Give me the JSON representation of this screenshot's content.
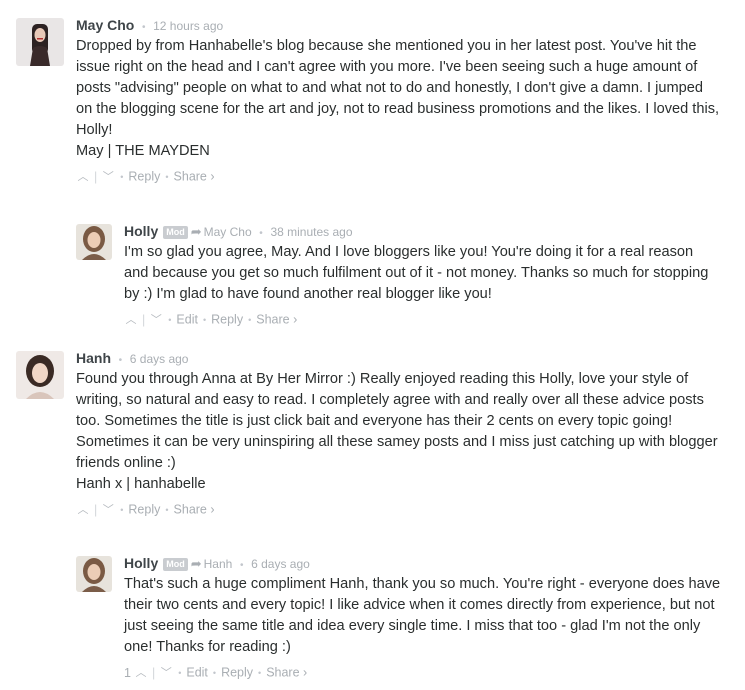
{
  "comments": [
    {
      "author": "May Cho",
      "time": "12 hours ago",
      "paragraphs": [
        "Dropped by from Hanhabelle's blog because she mentioned you in her latest post. You've hit the issue right on the head and I can't agree with you more. I've been seeing such a huge amount of posts \"advising\" people on what to and what not to do and honestly, I don't give a damn. I jumped on the blogging scene for the art and joy, not to read business promotions and the likes. I loved this, Holly!",
        "May | THE MAYDEN"
      ],
      "actions": {
        "reply": "Reply",
        "share": "Share ›"
      },
      "reply": {
        "author": "Holly",
        "badge": "Mod",
        "reply_to": "May Cho",
        "time": "38 minutes ago",
        "paragraphs": [
          "I'm so glad you agree, May. And I love bloggers like you! You're doing it for a real reason and because you get so much fulfilment out of it - not money. Thanks so much for stopping by :) I'm glad to have found another real blogger like you!"
        ],
        "actions": {
          "edit": "Edit",
          "reply": "Reply",
          "share": "Share ›"
        }
      }
    },
    {
      "author": "Hanh",
      "time": "6 days ago",
      "paragraphs": [
        "Found you through Anna at By Her Mirror :) Really enjoyed reading this Holly, love your style of writing, so natural and easy to read. I completely agree with and really over all these advice posts too. Sometimes the title is just click bait and everyone has their 2 cents on every topic going! Sometimes it can be very uninspiring all these samey posts and I miss just catching up with blogger friends online :)",
        "Hanh x | hanhabelle"
      ],
      "actions": {
        "reply": "Reply",
        "share": "Share ›"
      },
      "reply": {
        "author": "Holly",
        "badge": "Mod",
        "reply_to": "Hanh",
        "time": "6 days ago",
        "paragraphs": [
          "That's such a huge compliment Hanh, thank you so much. You're right - everyone does have their two cents and every topic! I like advice when it comes directly from experience, but not just seeing the same title and idea every single time. I miss that too - glad I'm not the only one! Thanks for reading :)"
        ],
        "upvotes": "1",
        "actions": {
          "edit": "Edit",
          "reply": "Reply",
          "share": "Share ›"
        }
      }
    }
  ],
  "icons": {
    "upvote": "chevron-up-icon",
    "downvote": "chevron-down-icon",
    "reply_to": "reply-arrow-icon"
  }
}
